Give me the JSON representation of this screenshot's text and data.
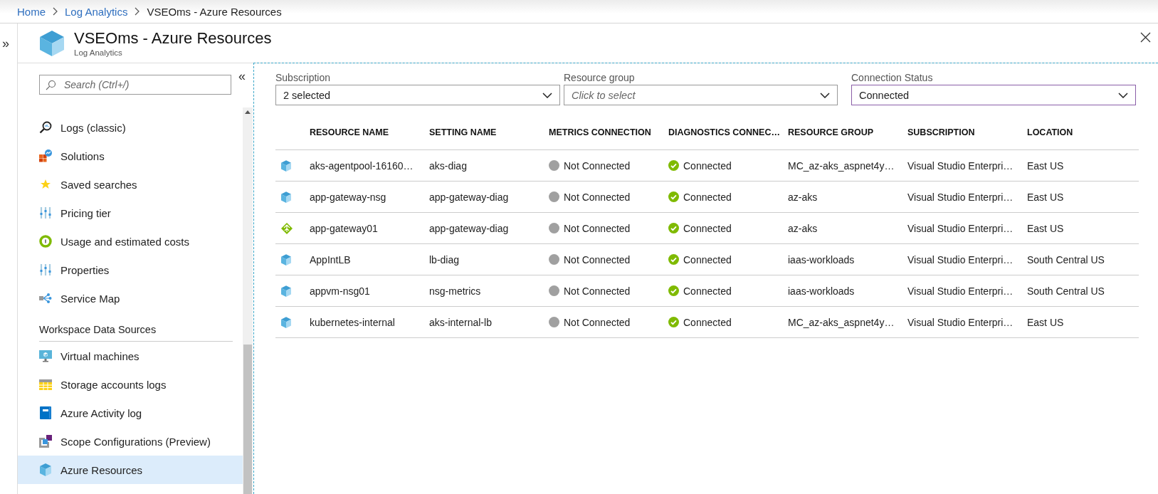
{
  "breadcrumb": [
    {
      "label": "Home",
      "link": true
    },
    {
      "label": "Log Analytics",
      "link": true
    },
    {
      "label": "VSEOms - Azure Resources",
      "link": false
    }
  ],
  "expand_glyph": "»",
  "blade": {
    "title": "VSEOms - Azure Resources",
    "subtitle": "Log Analytics"
  },
  "sidebar": {
    "search": {
      "placeholder": "Search (Ctrl+/)"
    },
    "collapse_glyph": "«",
    "items": [
      {
        "kind": "item",
        "label": "Logs (classic)",
        "selected": false
      },
      {
        "kind": "item",
        "label": "Solutions",
        "selected": false
      },
      {
        "kind": "item",
        "label": "Saved searches",
        "selected": false
      },
      {
        "kind": "item",
        "label": "Pricing tier",
        "selected": false
      },
      {
        "kind": "item",
        "label": "Usage and estimated costs",
        "selected": false
      },
      {
        "kind": "item",
        "label": "Properties",
        "selected": false
      },
      {
        "kind": "item",
        "label": "Service Map",
        "selected": false
      },
      {
        "kind": "heading",
        "label": "Workspace Data Sources"
      },
      {
        "kind": "item",
        "label": "Virtual machines",
        "selected": false
      },
      {
        "kind": "item",
        "label": "Storage accounts logs",
        "selected": false
      },
      {
        "kind": "item",
        "label": "Azure Activity log",
        "selected": false
      },
      {
        "kind": "item",
        "label": "Scope Configurations (Preview)",
        "selected": false
      },
      {
        "kind": "item",
        "label": "Azure Resources",
        "selected": true
      }
    ]
  },
  "filters": [
    {
      "label": "Subscription",
      "value": "2 selected",
      "focused": false
    },
    {
      "label": "Resource group",
      "placeholder": "Click to select",
      "focused": false
    },
    {
      "label": "Connection Status",
      "value": "Connected",
      "focused": true
    }
  ],
  "table": {
    "columns": [
      "RESOURCE NAME",
      "SETTING NAME",
      "METRICS CONNECTION",
      "DIAGNOSTICS CONNEC…",
      "RESOURCE GROUP",
      "SUBSCRIPTION",
      "LOCATION"
    ],
    "rows": [
      {
        "kind": "cube",
        "resource_name": "aks-agentpool-16160…",
        "setting_name": "aks-diag",
        "metrics": {
          "connected": false,
          "text": "Not Connected"
        },
        "diagnostics": {
          "connected": true,
          "text": "Connected"
        },
        "resource_group": "MC_az-aks_aspnet4y…",
        "subscription": "Visual Studio Enterpri…",
        "location": "East US"
      },
      {
        "kind": "cube",
        "resource_name": "app-gateway-nsg",
        "setting_name": "app-gateway-diag",
        "metrics": {
          "connected": false,
          "text": "Not Connected"
        },
        "diagnostics": {
          "connected": true,
          "text": "Connected"
        },
        "resource_group": "az-aks",
        "subscription": "Visual Studio Enterpri…",
        "location": "East US"
      },
      {
        "kind": "gateway",
        "resource_name": "app-gateway01",
        "setting_name": "app-gateway-diag",
        "metrics": {
          "connected": false,
          "text": "Not Connected"
        },
        "diagnostics": {
          "connected": true,
          "text": "Connected"
        },
        "resource_group": "az-aks",
        "subscription": "Visual Studio Enterpri…",
        "location": "East US"
      },
      {
        "kind": "cube",
        "resource_name": "AppIntLB",
        "setting_name": "lb-diag",
        "metrics": {
          "connected": false,
          "text": "Not Connected"
        },
        "diagnostics": {
          "connected": true,
          "text": "Connected"
        },
        "resource_group": "iaas-workloads",
        "subscription": "Visual Studio Enterpri…",
        "location": "South Central US"
      },
      {
        "kind": "cube",
        "resource_name": "appvm-nsg01",
        "setting_name": "nsg-metrics",
        "metrics": {
          "connected": false,
          "text": "Not Connected"
        },
        "diagnostics": {
          "connected": true,
          "text": "Connected"
        },
        "resource_group": "iaas-workloads",
        "subscription": "Visual Studio Enterpri…",
        "location": "South Central US"
      },
      {
        "kind": "cube",
        "resource_name": "kubernetes-internal",
        "setting_name": "aks-internal-lb",
        "metrics": {
          "connected": false,
          "text": "Not Connected"
        },
        "diagnostics": {
          "connected": true,
          "text": "Connected"
        },
        "resource_group": "MC_az-aks_aspnet4y…",
        "subscription": "Visual Studio Enterpri…",
        "location": "East US"
      }
    ]
  }
}
